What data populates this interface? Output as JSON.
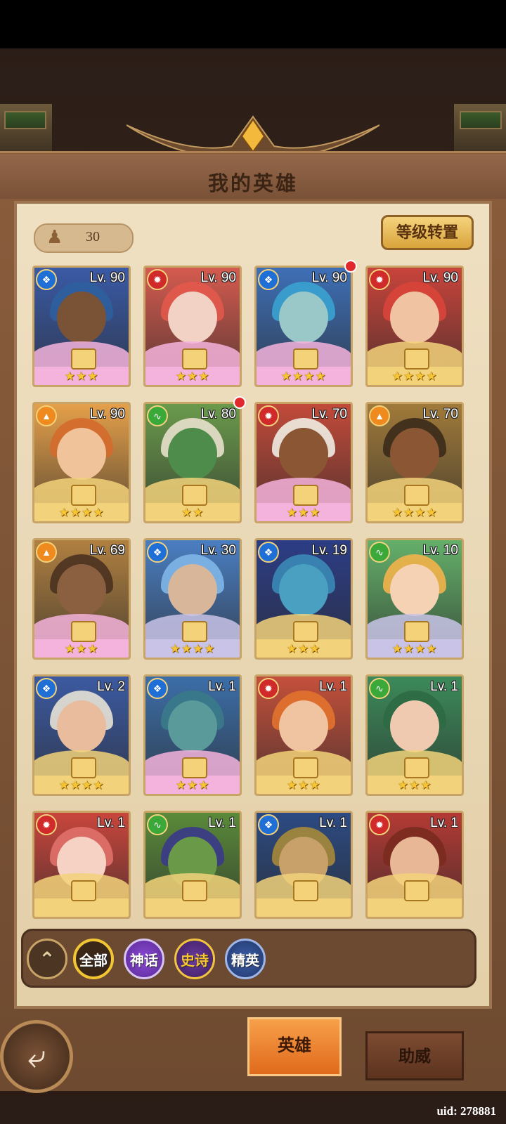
{
  "header": {
    "title": "我的英雄"
  },
  "hero_count": "30",
  "reset_button_label": "等级转置",
  "heroes": [
    {
      "level": "Lv. 90",
      "element": "water",
      "stars": "★★★",
      "rarity": "mythic",
      "bg": "#3a5aa6",
      "hair": "#2f5f9e",
      "skin": "#7a5236",
      "red_dot": false
    },
    {
      "level": "Lv. 90",
      "element": "fire",
      "stars": "★★★",
      "rarity": "mythic",
      "bg": "#d55b4f",
      "hair": "#e2594b",
      "skin": "#f1d2c5",
      "red_dot": false
    },
    {
      "level": "Lv. 90",
      "element": "water",
      "stars": "★★★★",
      "rarity": "mythic",
      "bg": "#3e6fb6",
      "hair": "#3aa2d0",
      "skin": "#9ac8c8",
      "red_dot": true
    },
    {
      "level": "Lv. 90",
      "element": "fire",
      "stars": "★★★★",
      "rarity": "epic",
      "bg": "#c8443b",
      "hair": "#d9443a",
      "skin": "#f0c4a3",
      "red_dot": false
    },
    {
      "level": "Lv. 90",
      "element": "earth",
      "stars": "★★★★",
      "rarity": "epic",
      "bg": "#e5a04a",
      "hair": "#d46a2c",
      "skin": "#f0c39a",
      "red_dot": false
    },
    {
      "level": "Lv. 80",
      "element": "wind",
      "stars": "★★",
      "rarity": "epic",
      "bg": "#6a9a4c",
      "hair": "#e8e0cc",
      "skin": "#4e8c4b",
      "red_dot": true
    },
    {
      "level": "Lv. 70",
      "element": "fire",
      "stars": "★★★",
      "rarity": "mythic",
      "bg": "#c24a3a",
      "hair": "#f0ece2",
      "skin": "#8a5634",
      "red_dot": false
    },
    {
      "level": "Lv. 70",
      "element": "earth",
      "stars": "★★★★",
      "rarity": "epic",
      "bg": "#a07a3a",
      "hair": "#3a2a1a",
      "skin": "#8a5634",
      "red_dot": false
    },
    {
      "level": "Lv. 69",
      "element": "earth",
      "stars": "★★★",
      "rarity": "mythic",
      "bg": "#b08040",
      "hair": "#4a3220",
      "skin": "#8a6040",
      "red_dot": false
    },
    {
      "level": "Lv. 30",
      "element": "water",
      "stars": "★★★★",
      "rarity": "legend",
      "bg": "#4a7ec2",
      "hair": "#7fb6e8",
      "skin": "#d8b69a",
      "red_dot": false
    },
    {
      "level": "Lv. 19",
      "element": "water",
      "stars": "★★★",
      "rarity": "epic",
      "bg": "#2c3d86",
      "hair": "#3a8ab6",
      "skin": "#4aa0c0",
      "red_dot": false
    },
    {
      "level": "Lv. 10",
      "element": "wind",
      "stars": "★★★★",
      "rarity": "legend",
      "bg": "#64b06a",
      "hair": "#f2b34a",
      "skin": "#f6d2b4",
      "red_dot": false
    },
    {
      "level": "Lv. 2",
      "element": "water",
      "stars": "★★★★",
      "rarity": "epic",
      "bg": "#3c5aa2",
      "hair": "#e8e2d6",
      "skin": "#e8bc9c",
      "red_dot": false
    },
    {
      "level": "Lv. 1",
      "element": "water",
      "stars": "★★★",
      "rarity": "mythic",
      "bg": "#3c6ea8",
      "hair": "#3a7a8a",
      "skin": "#5a9a9a",
      "red_dot": false
    },
    {
      "level": "Lv. 1",
      "element": "fire",
      "stars": "★★★",
      "rarity": "epic",
      "bg": "#c4503c",
      "hair": "#e2722e",
      "skin": "#f0c4a0",
      "red_dot": false
    },
    {
      "level": "Lv. 1",
      "element": "wind",
      "stars": "★★★",
      "rarity": "epic",
      "bg": "#3c8a5a",
      "hair": "#2e6a44",
      "skin": "#f0cab0",
      "red_dot": false
    },
    {
      "level": "Lv. 1",
      "element": "fire",
      "stars": "",
      "rarity": "epic",
      "bg": "#c9463c",
      "hair": "#e0706a",
      "skin": "#f6d2c4",
      "red_dot": false
    },
    {
      "level": "Lv. 1",
      "element": "wind",
      "stars": "",
      "rarity": "epic",
      "bg": "#5a8a3a",
      "hair": "#3a3a8a",
      "skin": "#6a9a48",
      "red_dot": false
    },
    {
      "level": "Lv. 1",
      "element": "water",
      "stars": "",
      "rarity": "epic",
      "bg": "#2c4a82",
      "hair": "#a68a3a",
      "skin": "#c8a06a",
      "red_dot": false
    },
    {
      "level": "Lv. 1",
      "element": "fire",
      "stars": "",
      "rarity": "epic",
      "bg": "#b43a34",
      "hair": "#7a2a1e",
      "skin": "#e8b896",
      "red_dot": false
    }
  ],
  "filters": {
    "collapse_icon": "double-chevron-up-icon",
    "all": "全部",
    "mythic": "神话",
    "epic": "史诗",
    "elite": "精英"
  },
  "tabs": {
    "heroes": "英雄",
    "support": "助威"
  },
  "back_icon": "back-arrow-icon",
  "uid": "uid: 278881",
  "colors": {
    "water": "#1f6fd6",
    "fire": "#d02a2a",
    "earth": "#ef8a1f",
    "wind": "#3aa93a",
    "mythic_band": "#f4b3dc",
    "legend_band": "#c9c3e8",
    "epic_band": "#f2d27a"
  }
}
